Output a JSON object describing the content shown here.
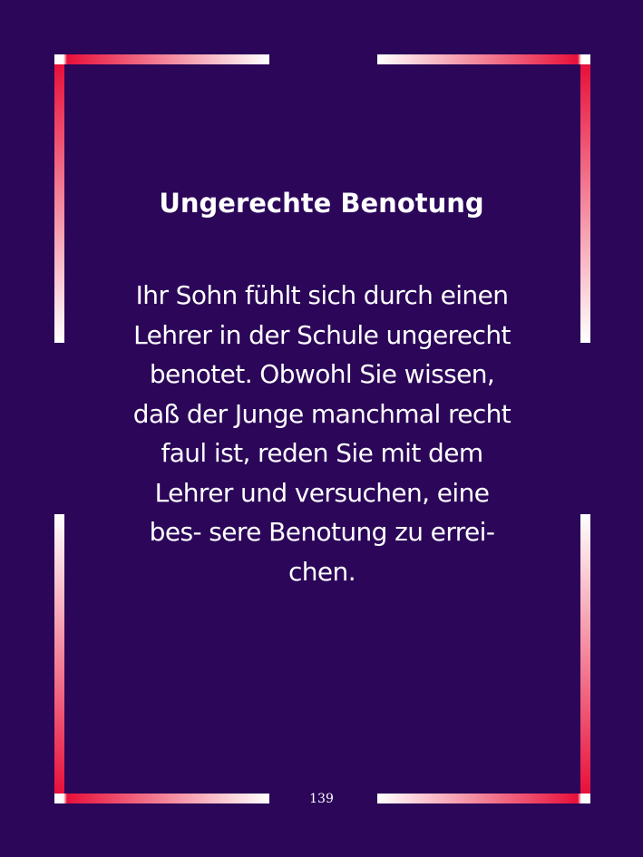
{
  "document": {
    "title": "Ungerechte Benotung",
    "body_lines": [
      "Ihr Sohn fühlt sich durch einen",
      "Lehrer in der Schule ungerecht",
      "benotet. Obwohl Sie wissen,",
      "daß der Junge manchmal recht",
      "faul ist, reden Sie mit dem",
      "Lehrer und versuchen, eine",
      "bes- sere Benotung zu errei-",
      "chen."
    ],
    "page_number": "139"
  },
  "colors": {
    "background": "#2b0659",
    "frame_accent": "#e8103a",
    "frame_light": "#ffffff",
    "text": "#ffffff"
  }
}
